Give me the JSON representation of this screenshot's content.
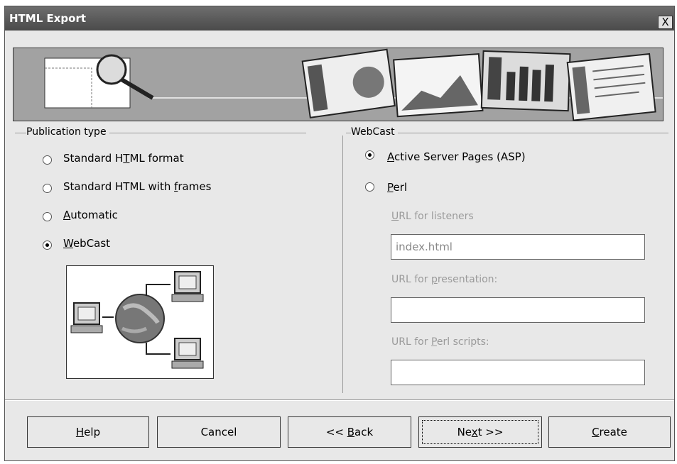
{
  "window": {
    "title": "HTML Export",
    "close": "X"
  },
  "publication": {
    "label": "Publication type",
    "options": [
      {
        "pre": "Standard H",
        "u": "T",
        "post": "ML format"
      },
      {
        "pre": "Standard HTML with ",
        "u": "f",
        "post": "rames"
      },
      {
        "pre": "",
        "u": "A",
        "post": "utomatic"
      },
      {
        "pre": "",
        "u": "W",
        "post": "ebCast"
      }
    ],
    "selected": "WebCast"
  },
  "webcast": {
    "label": "WebCast",
    "asp": {
      "u": "A",
      "post": "ctive Server Pages (ASP)"
    },
    "perl": {
      "u": "P",
      "post": "erl"
    },
    "selected": "Active Server Pages (ASP)",
    "listeners": {
      "u": "U",
      "post": "RL for listeners",
      "value": "index.html"
    },
    "presentation": {
      "pre": "URL for ",
      "u": "p",
      "post": "resentation:",
      "value": ""
    },
    "scripts": {
      "pre": "URL for ",
      "u": "P",
      "post": "erl scripts:",
      "value": ""
    }
  },
  "buttons": {
    "help": {
      "u": "H",
      "post": "elp"
    },
    "cancel": "Cancel",
    "back": {
      "pre": "<< ",
      "u": "B",
      "post": "ack"
    },
    "next": {
      "pre": "Ne",
      "u": "x",
      "post": "t >>"
    },
    "create": {
      "u": "C",
      "post": "reate"
    }
  }
}
